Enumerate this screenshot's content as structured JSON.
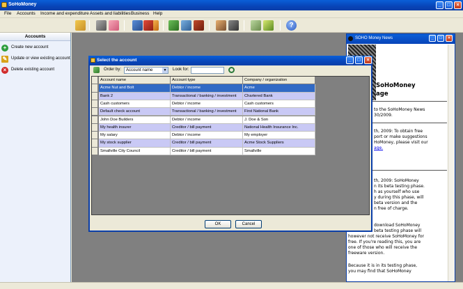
{
  "app": {
    "title": "SoHoMoney"
  },
  "menu": [
    "File",
    "Accounts",
    "Income and expenditure",
    "Assets and liabilities",
    "Business",
    "Help"
  ],
  "toolbar": {
    "buttons": [
      "accounts-icon",
      "cash-icon",
      "bank-icon",
      "invoice-icon",
      "building-icon",
      "pen-icon",
      "money-icon",
      "phone-icon",
      "car-icon",
      "people-icon",
      "chart-icon",
      "calculator-icon",
      "tools-icon",
      "help-icon"
    ]
  },
  "sidebar": {
    "title": "Accounts",
    "items": [
      {
        "label": "Create new account",
        "icon": "plus-icon",
        "color": "#2e9e3e"
      },
      {
        "label": "Update or view existing account",
        "icon": "pencil-icon",
        "color": "#d9a21b"
      },
      {
        "label": "Delete existing account",
        "icon": "x-icon",
        "color": "#d12b2b"
      }
    ]
  },
  "news": {
    "title": "SOHO Money News",
    "lines": [
      "SoHoMoney",
      "age",
      "to the SoHoMoney News",
      "30/2009.",
      "th, 2009: To obtain free",
      "port or make suggestions",
      "HoMoney, please visit our",
      "age.",
      "th, 2009: SoHoMoney",
      "n its beta testing phase.",
      "h as yourself who use",
      "y during this phase, will",
      "beta version and the",
      "n free of charge.",
      "download SoHoMoney",
      "beta testing phase will",
      "however not receive SoHoMoney for",
      "free. If you're reading this, you are",
      "one of those who will receive the",
      "freeware version.",
      "Because it is in its testing phase,",
      "you may find that SoHoMoney"
    ]
  },
  "dialog": {
    "title": "Select the account",
    "order_by_label": "Order by:",
    "order_by_value": "Account name",
    "look_for_label": "Look for:",
    "look_for_value": "",
    "columns": [
      "Account name",
      "Account type",
      "Company / organization"
    ],
    "rows": [
      [
        "Acme Nut and Bolt",
        "Debtor / income",
        "Acme"
      ],
      [
        "Bank 2",
        "Transactional / banking / investment",
        "Chartered Bank"
      ],
      [
        "Cash customers",
        "Debtor / income",
        "Cash customers"
      ],
      [
        "Default check account",
        "Transactional / banking / investment",
        "First National Bank"
      ],
      [
        "John Doe Builders",
        "Debtor / income",
        "J. Doe & Son"
      ],
      [
        "My health insurer",
        "Creditor / bill payment",
        "National Health Insurance Inc."
      ],
      [
        "My salary",
        "Debtor / income",
        "My employer"
      ],
      [
        "My stock supplier",
        "Creditor / bill payment",
        "Acme Stock Suppliers"
      ],
      [
        "Smallville City Council",
        "Creditor / bill payment",
        "Smallville"
      ]
    ],
    "ok_label": "OK",
    "cancel_label": "Cancel"
  },
  "colors": {
    "accent": "#0a4fc8",
    "selected_row": "#316ac5",
    "alt_row": "#c9c9f5",
    "workspace": "#808080"
  }
}
